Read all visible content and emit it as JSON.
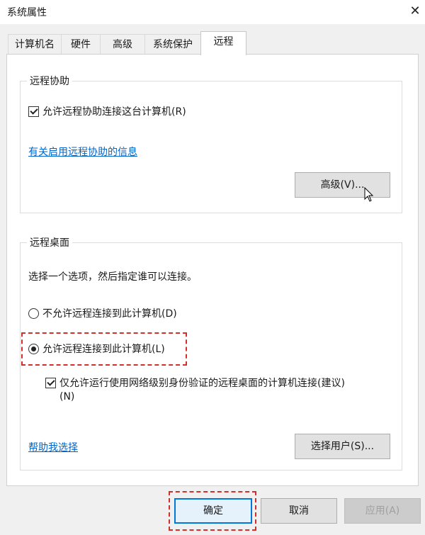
{
  "window": {
    "title": "系统属性",
    "close": "✕"
  },
  "tabs": [
    "计算机名",
    "硬件",
    "高级",
    "系统保护",
    "远程"
  ],
  "active_tab": "远程",
  "remote_assistance": {
    "legend": "远程协助",
    "checkbox_label": "允许远程协助连接这台计算机(R)",
    "checked": true,
    "link": "有关启用远程协助的信息",
    "advanced_button": "高级(V)..."
  },
  "remote_desktop": {
    "legend": "远程桌面",
    "instruction": "选择一个选项，然后指定谁可以连接。",
    "radio_deny": "不允许远程连接到此计算机(D)",
    "radio_allow": "允许远程连接到此计算机(L)",
    "selected": "allow",
    "nla_label_line1": "仅允许运行使用网络级别身份验证的远程桌面的计算机连接(建议)",
    "nla_label_line2": "(N)",
    "nla_checked": true,
    "help_link": "帮助我选择",
    "select_users_button": "选择用户(S)..."
  },
  "footer": {
    "ok": "确定",
    "cancel": "取消",
    "apply": "应用(A)"
  },
  "colors": {
    "link": "#0066cc",
    "highlight": "#d0312d",
    "focus": "#0078d7"
  }
}
